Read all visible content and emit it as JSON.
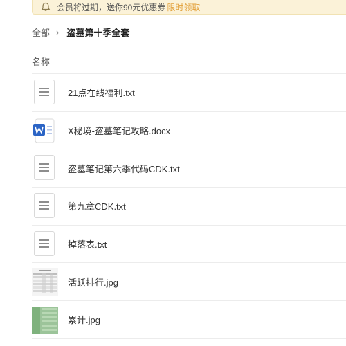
{
  "banner": {
    "text": "会员将过期，送你90元优惠券",
    "link": "限时领取"
  },
  "breadcrumb": {
    "root": "全部",
    "separator": "›",
    "current": "盗墓第十季全套"
  },
  "list": {
    "header_name": "名称",
    "files": [
      {
        "name": "21点在线福利.txt",
        "icon": "txt-file-icon"
      },
      {
        "name": "X秘境-盗墓笔记攻略.docx",
        "icon": "word-doc-icon"
      },
      {
        "name": "盗墓笔记第六季代码CDK.txt",
        "icon": "txt-file-icon"
      },
      {
        "name": "第九章CDK.txt",
        "icon": "txt-file-icon"
      },
      {
        "name": "掉落表.txt",
        "icon": "txt-file-icon"
      },
      {
        "name": "活跃排行.jpg",
        "icon": "image-thumbnail"
      },
      {
        "name": "累计.jpg",
        "icon": "image-thumbnail"
      }
    ]
  },
  "colors": {
    "banner_bg": "#fbf2d8",
    "banner_link": "#e2a03a",
    "word_blue": "#2b64c5"
  }
}
